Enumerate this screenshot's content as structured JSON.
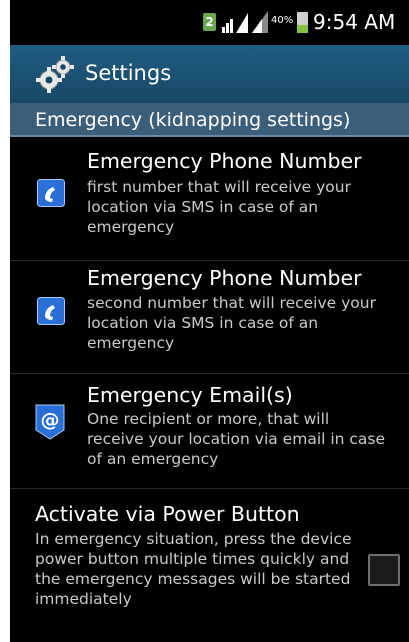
{
  "status_bar": {
    "sim_label": "2",
    "battery_percent": "40%",
    "battery_level": 0.4,
    "time": "9:54 AM"
  },
  "action_bar": {
    "title": "Settings",
    "icon": "gear-icon"
  },
  "category": {
    "label": "Emergency (kidnapping settings)"
  },
  "preferences": [
    {
      "title": "Emergency Phone Number",
      "summary": "first number that will receive your location via SMS in case of an emergency",
      "icon": "phone-icon"
    },
    {
      "title": "Emergency Phone Number",
      "summary": "second number that will receive your location via SMS in case of an emergency",
      "icon": "phone-icon"
    },
    {
      "title": "Emergency Email(s)",
      "summary": "One recipient or more, that will receive your location via email in case of an emergency",
      "icon": "email-icon"
    },
    {
      "title": "Activate via Power Button",
      "summary": "In emergency situation, press the device power button multiple times quickly and the emergency messages will be started immediately",
      "checked": false
    }
  ],
  "colors": {
    "action_bar": "#205d82",
    "category": "#3b5e7b",
    "background": "#000000",
    "icon_blue": "#2a6fd6"
  }
}
